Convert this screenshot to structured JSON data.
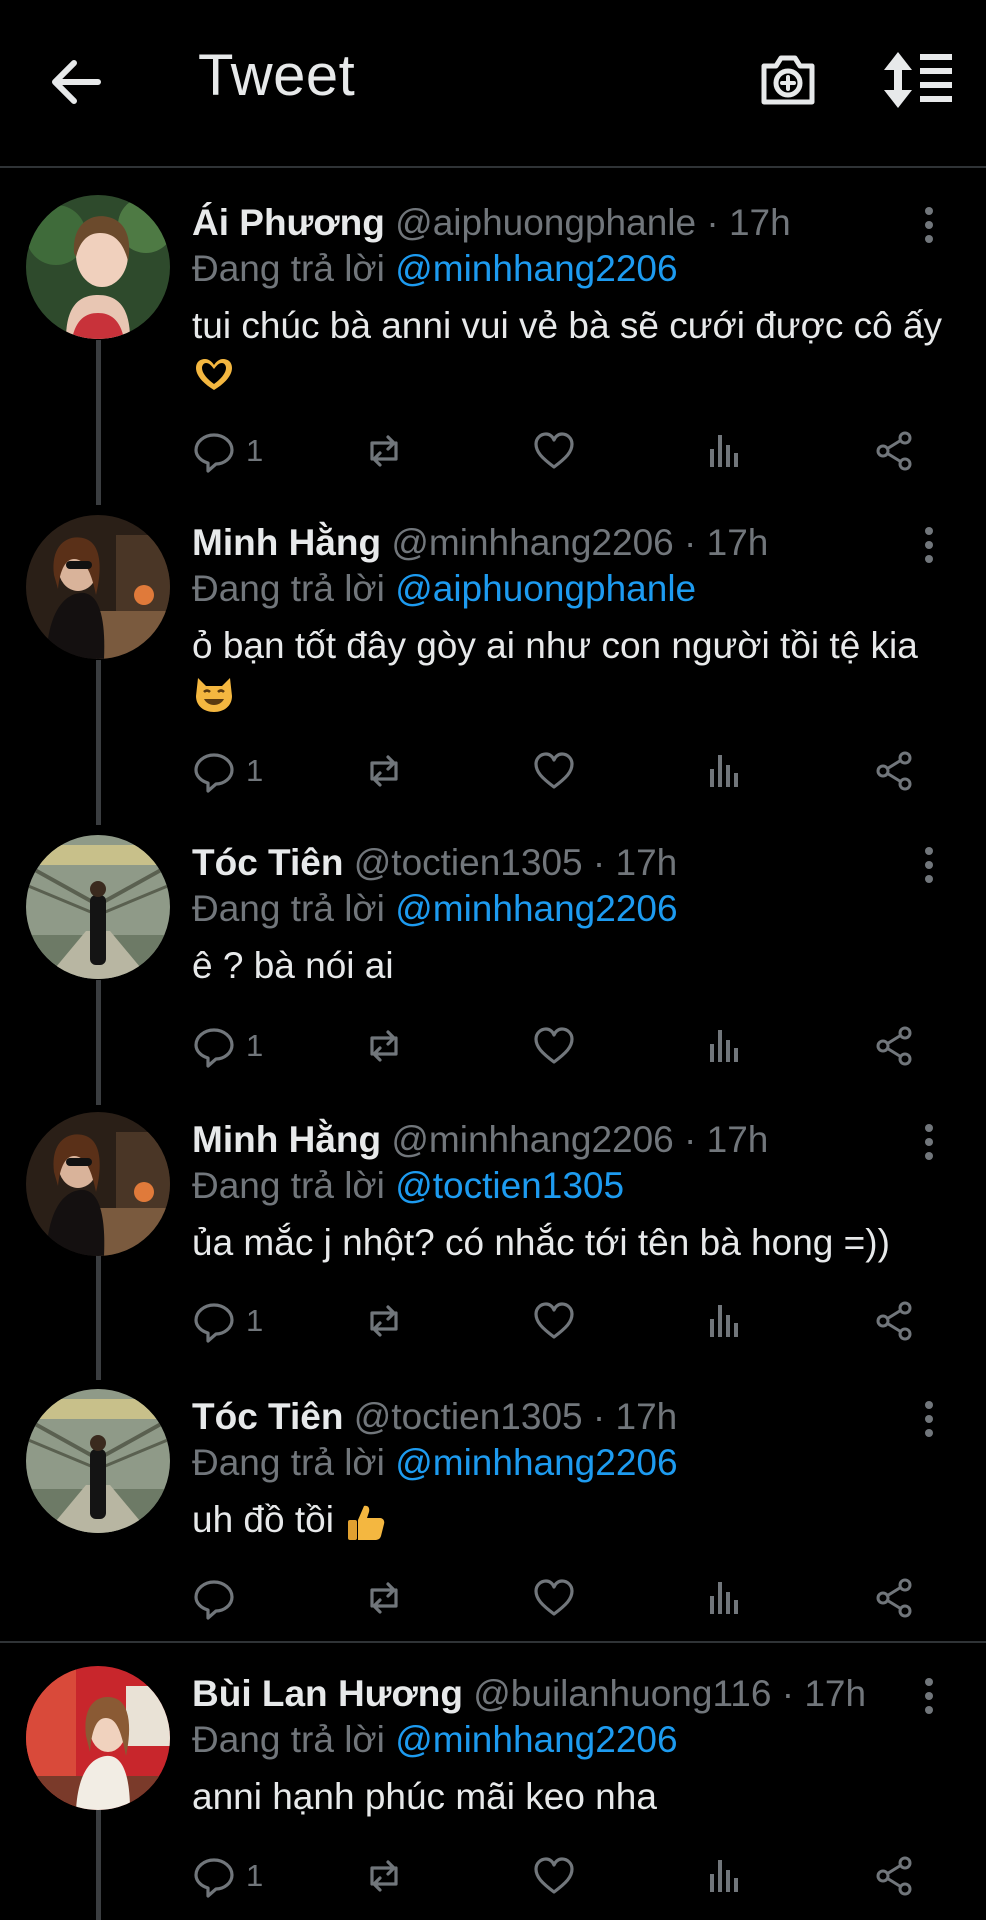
{
  "header": {
    "title": "Tweet",
    "back_icon": "arrow-left-icon",
    "camera_icon": "camera-plus-icon",
    "sort_icon": "sort-lines-icon"
  },
  "reply_prefix": "Đang trả lời",
  "colors": {
    "link": "#1d9bf0",
    "muted": "#71767b",
    "text": "#e7e9ea",
    "background": "#000000"
  },
  "tweets": [
    {
      "name": "Ái Phương",
      "handle": "@aiphuongphanle",
      "separator": "·",
      "time": "17h",
      "reply_to": "@minhhang2206",
      "text": "tui chúc bà anni vui vẻ bà sẽ cưới được cô ấy",
      "emoji": "heart-hands-emoji",
      "reply_count": "1"
    },
    {
      "name": "Minh Hằng",
      "handle": "@minhhang2206",
      "separator": "·",
      "time": "17h",
      "reply_to": "@aiphuongphanle",
      "text": "ỏ bạn tốt đây gòy ai như con người tồi tệ kia",
      "emoji": "grinning-cat-emoji",
      "reply_count": "1"
    },
    {
      "name": "Tóc Tiên",
      "handle": "@toctien1305",
      "separator": "·",
      "time": "17h",
      "reply_to": "@minhhang2206",
      "text": "ê ? bà nói ai",
      "reply_count": "1"
    },
    {
      "name": "Minh Hằng",
      "handle": "@minhhang2206",
      "separator": "·",
      "time": "17h",
      "reply_to": "@toctien1305",
      "text": "ủa mắc j nhột? có nhắc tới tên bà hong =))",
      "reply_count": "1"
    },
    {
      "name": "Tóc Tiên",
      "handle": "@toctien1305",
      "separator": "·",
      "time": "17h",
      "reply_to": "@minhhang2206",
      "text": "uh đồ tồi",
      "emoji": "thumbs-up-emoji",
      "reply_count": ""
    },
    {
      "name": "Bùi Lan Hương",
      "handle": "@builanhuong116",
      "separator": "·",
      "time": "17h",
      "reply_to": "@minhhang2206",
      "text": "anni hạnh phúc mãi keo nha",
      "reply_count": "1"
    }
  ]
}
